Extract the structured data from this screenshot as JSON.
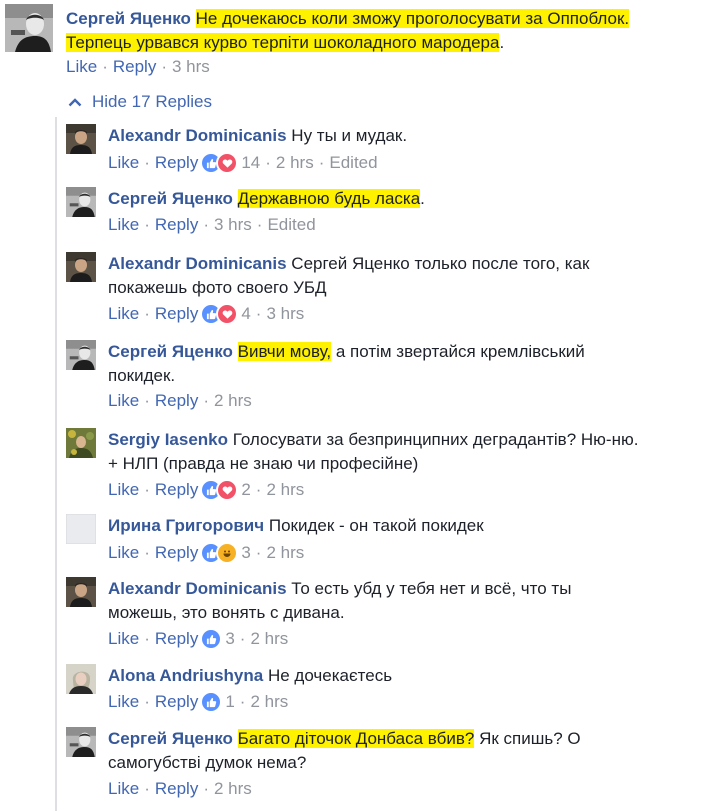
{
  "main_comment": {
    "author": "Сергей Яценко",
    "text_hl_1": "Не дочекаюсь коли зможу проголосувати за Оппоблок.",
    "text_hl_2": "Терпець урвався курво терпіти шоколадного мародера",
    "text_tail": ".",
    "like": "Like",
    "reply": "Reply",
    "time": "3 hrs"
  },
  "hide_replies": "Hide 17 Replies",
  "sep": "·",
  "replies": [
    {
      "author": "Alexandr Dominicanis",
      "text": "Ну ты и мудак.",
      "like": "Like",
      "reply": "Reply",
      "count": "14",
      "time": "2 hrs",
      "edited": "Edited",
      "reactions": [
        "like-icon",
        "love-icon"
      ]
    },
    {
      "author": "Сергей Яценко",
      "text_hl": "Державною будь ласка",
      "text_tail": ".",
      "like": "Like",
      "reply": "Reply",
      "time": "3 hrs",
      "edited": "Edited"
    },
    {
      "author": "Alexandr Dominicanis",
      "line1": "Сергей Яценко только после того, как",
      "line2": "покажешь фото своего УБД",
      "like": "Like",
      "reply": "Reply",
      "count": "4",
      "time": "3 hrs",
      "reactions": [
        "like-icon",
        "love-icon"
      ]
    },
    {
      "author": "Сергей Яценко",
      "text_hl": "Вивчи мову,",
      "line1_tail": " а потім звертайся кремлівський",
      "line2": "покидек.",
      "like": "Like",
      "reply": "Reply",
      "time": "2 hrs"
    },
    {
      "author": "Sergiy Iasenko",
      "line1": "Голосувати за безпринципних деградантів? Ню-ню.",
      "line2": "+ НЛП (правда не знаю чи професійне)",
      "like": "Like",
      "reply": "Reply",
      "count": "2",
      "time": "2 hrs",
      "reactions": [
        "like-icon",
        "love-icon"
      ]
    },
    {
      "author": "Ирина Григорович",
      "text": "Покидек - он такой покидек",
      "like": "Like",
      "reply": "Reply",
      "count": "3",
      "time": "2 hrs",
      "reactions": [
        "like-icon",
        "haha-icon"
      ]
    },
    {
      "author": "Alexandr Dominicanis",
      "line1": "То есть убд у тебя нет и всё, что ты",
      "line2": "можешь, это вонять с дивана.",
      "like": "Like",
      "reply": "Reply",
      "count": "3",
      "time": "2 hrs",
      "reactions": [
        "like-icon"
      ]
    },
    {
      "author": "Alona Andriushyna",
      "text": "Не дочекаєтесь",
      "like": "Like",
      "reply": "Reply",
      "count": "1",
      "time": "2 hrs",
      "reactions": [
        "like-icon"
      ]
    },
    {
      "author": "Сергей Яценко",
      "text_hl": "Багато діточок Донбаса вбив?",
      "line1_tail": " Як спишь? О",
      "line2": "самогубстві думок нема?",
      "like": "Like",
      "reply": "Reply",
      "time": "2 hrs"
    }
  ],
  "colors": {
    "link": "#365899",
    "action": "#4267b2",
    "meta": "#90949c",
    "highlight": "#fff200",
    "like": "#5890ff",
    "love": "#f25268",
    "haha": "#f7b125"
  }
}
